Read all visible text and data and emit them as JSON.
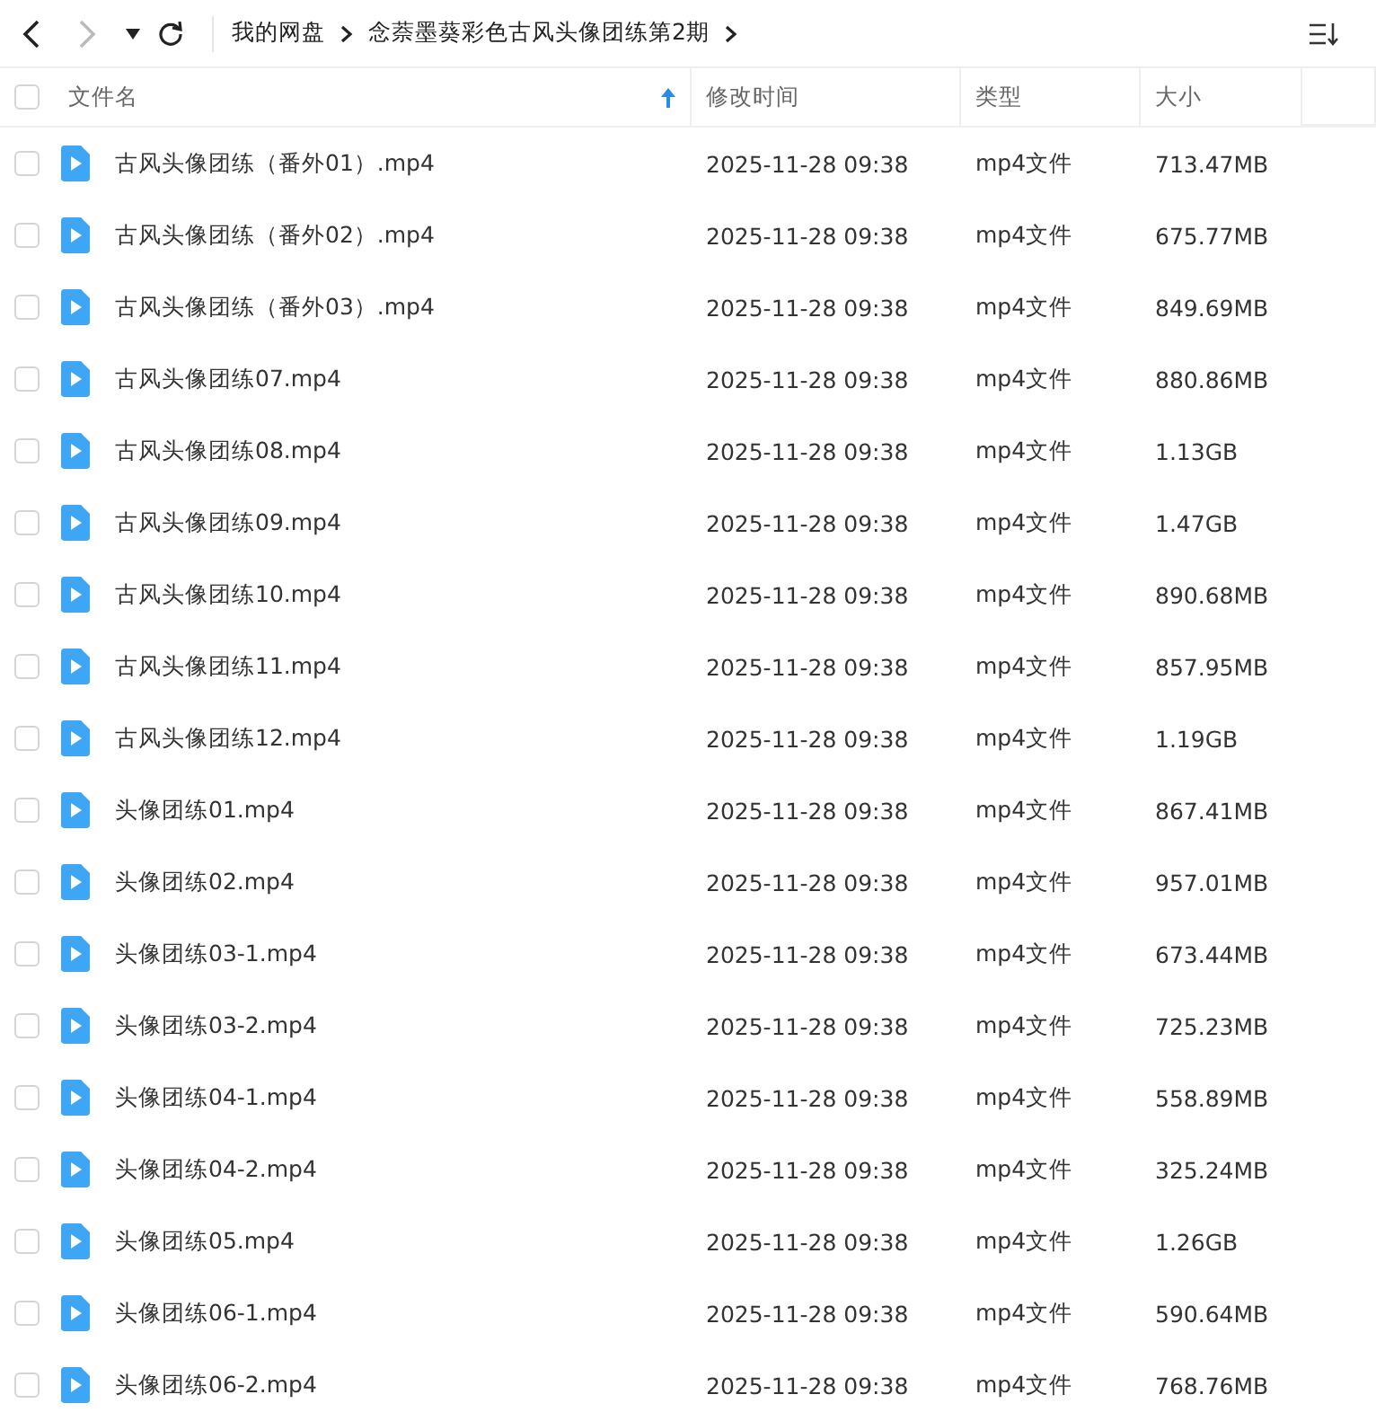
{
  "nav": {
    "back_disabled": false,
    "forward_disabled": true
  },
  "breadcrumb": [
    "我的网盘",
    "念萘墨葵彩色古风头像团练第2期"
  ],
  "header": {
    "checked": false,
    "columns": [
      {
        "label": "文件名",
        "sorted": true
      },
      {
        "label": "修改时间",
        "sorted": false
      },
      {
        "label": "类型",
        "sorted": false
      },
      {
        "label": "大小",
        "sorted": false
      }
    ]
  },
  "rows": [
    {
      "name": "古风头像团练（番外01）.mp4",
      "modified": "2025-11-28 09:38",
      "type": "mp4文件",
      "size": "713.47MB",
      "checked": false
    },
    {
      "name": "古风头像团练（番外02）.mp4",
      "modified": "2025-11-28 09:38",
      "type": "mp4文件",
      "size": "675.77MB",
      "checked": false
    },
    {
      "name": "古风头像团练（番外03）.mp4",
      "modified": "2025-11-28 09:38",
      "type": "mp4文件",
      "size": "849.69MB",
      "checked": false
    },
    {
      "name": "古风头像团练07.mp4",
      "modified": "2025-11-28 09:38",
      "type": "mp4文件",
      "size": "880.86MB",
      "checked": false
    },
    {
      "name": "古风头像团练08.mp4",
      "modified": "2025-11-28 09:38",
      "type": "mp4文件",
      "size": "1.13GB",
      "checked": false
    },
    {
      "name": "古风头像团练09.mp4",
      "modified": "2025-11-28 09:38",
      "type": "mp4文件",
      "size": "1.47GB",
      "checked": false
    },
    {
      "name": "古风头像团练10.mp4",
      "modified": "2025-11-28 09:38",
      "type": "mp4文件",
      "size": "890.68MB",
      "checked": false
    },
    {
      "name": "古风头像团练11.mp4",
      "modified": "2025-11-28 09:38",
      "type": "mp4文件",
      "size": "857.95MB",
      "checked": false
    },
    {
      "name": "古风头像团练12.mp4",
      "modified": "2025-11-28 09:38",
      "type": "mp4文件",
      "size": "1.19GB",
      "checked": false
    },
    {
      "name": "头像团练01.mp4",
      "modified": "2025-11-28 09:38",
      "type": "mp4文件",
      "size": "867.41MB",
      "checked": false
    },
    {
      "name": "头像团练02.mp4",
      "modified": "2025-11-28 09:38",
      "type": "mp4文件",
      "size": "957.01MB",
      "checked": false
    },
    {
      "name": "头像团练03-1.mp4",
      "modified": "2025-11-28 09:38",
      "type": "mp4文件",
      "size": "673.44MB",
      "checked": false
    },
    {
      "name": "头像团练03-2.mp4",
      "modified": "2025-11-28 09:38",
      "type": "mp4文件",
      "size": "725.23MB",
      "checked": false
    },
    {
      "name": "头像团练04-1.mp4",
      "modified": "2025-11-28 09:38",
      "type": "mp4文件",
      "size": "558.89MB",
      "checked": false
    },
    {
      "name": "头像团练04-2.mp4",
      "modified": "2025-11-28 09:38",
      "type": "mp4文件",
      "size": "325.24MB",
      "checked": false
    },
    {
      "name": "头像团练05.mp4",
      "modified": "2025-11-28 09:38",
      "type": "mp4文件",
      "size": "1.26GB",
      "checked": false
    },
    {
      "name": "头像团练06-1.mp4",
      "modified": "2025-11-28 09:38",
      "type": "mp4文件",
      "size": "590.64MB",
      "checked": false
    },
    {
      "name": "头像团练06-2.mp4",
      "modified": "2025-11-28 09:38",
      "type": "mp4文件",
      "size": "768.76MB",
      "checked": false
    }
  ]
}
